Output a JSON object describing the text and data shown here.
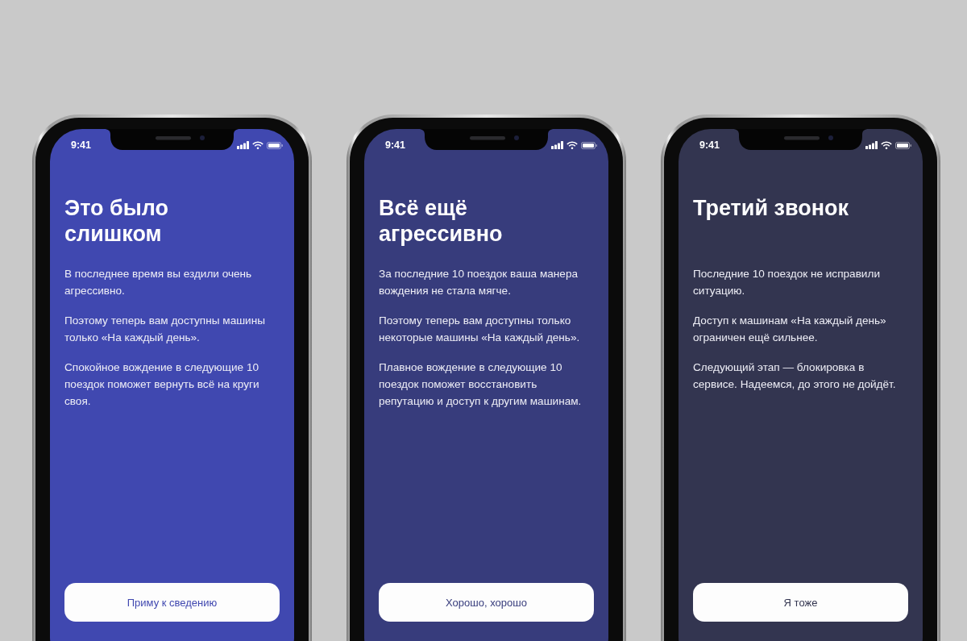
{
  "phones": [
    {
      "color": "#4048b0",
      "status_bar": {
        "time": "9:41"
      },
      "title": "Это было\nслишком",
      "paragraphs": [
        "В последнее время вы ездили очень агрессивно.",
        "Поэтому теперь вам доступны машины только «На каждый день».",
        "Спокойное вождение в следующие 10 поездок поможет вернуть всё на круги своя."
      ],
      "button": "Приму к сведению"
    },
    {
      "color": "#373c7c",
      "status_bar": {
        "time": "9:41"
      },
      "title": "Всё ещё\nагрессивно",
      "paragraphs": [
        "За последние 10 поездок ваша манера вождения не стала мягче.",
        "Поэтому теперь вам доступны только некоторые машины «На каждый день».",
        "Плавное вождение в следующие 10 поездок поможет восстановить репутацию и доступ к другим машинам."
      ],
      "button": "Хорошо, хорошо"
    },
    {
      "color": "#333550",
      "status_bar": {
        "time": "9:41"
      },
      "title": "Третий звонок",
      "paragraphs": [
        "Последние 10 поездок не исправили ситуацию.",
        "Доступ к машинам «На каждый день» ограничен ещё сильнее.",
        "Следующий этап — блокировка в сервисе. Надеемся, до этого не дойдёт."
      ],
      "button": "Я тоже"
    }
  ]
}
